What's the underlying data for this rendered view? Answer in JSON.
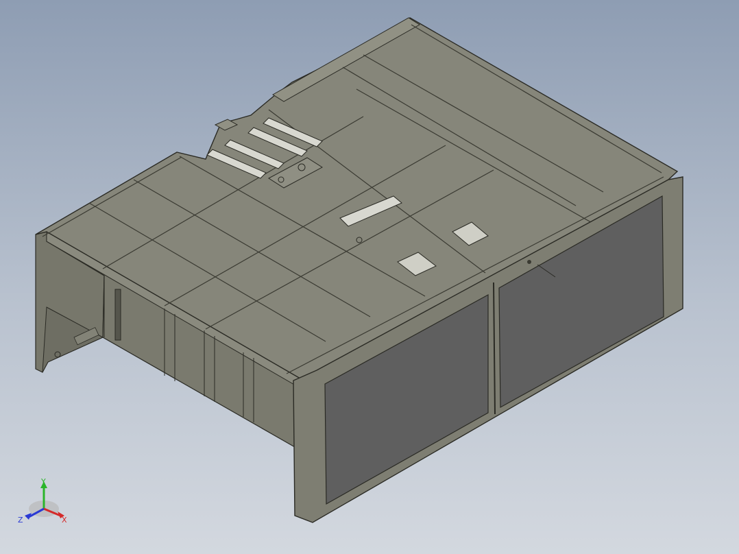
{
  "viewport": {
    "background_top": "#8e9db3",
    "background_bottom": "#d3d8df"
  },
  "model": {
    "body_color": "#86867a",
    "body_color_light": "#919184",
    "side_color": "#76766a",
    "panel_color": "#5f5f5f",
    "edge_color": "#2a2a24",
    "seam_color": "#3a3a32"
  },
  "triad": {
    "x_label": "X",
    "y_label": "Y",
    "z_label": "Z",
    "x_color": "#d42a2a",
    "y_color": "#2ab52a",
    "z_color": "#2a3ad4"
  }
}
